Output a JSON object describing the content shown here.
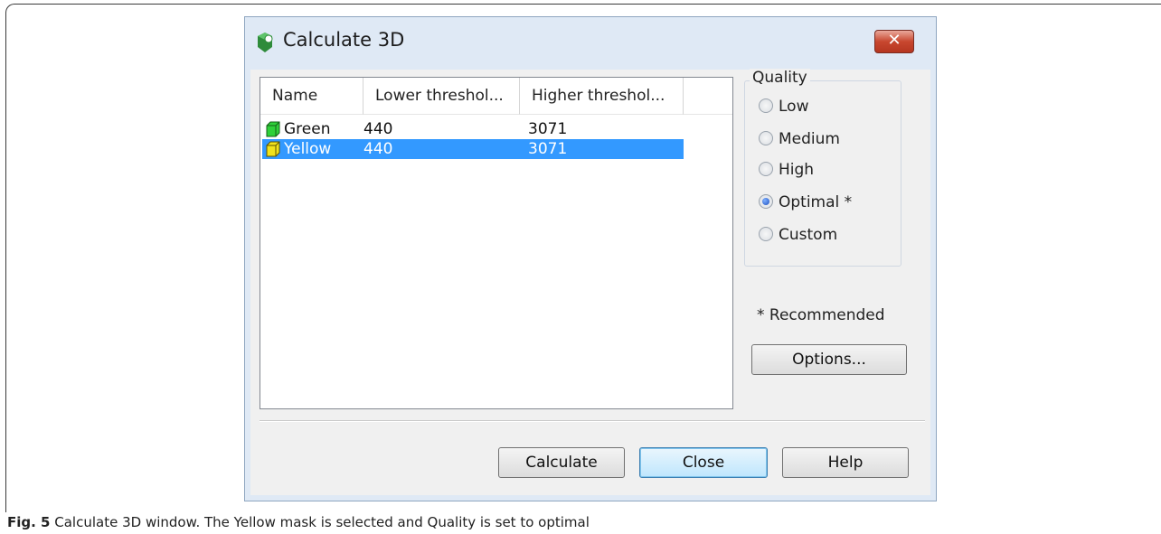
{
  "window": {
    "title": "Calculate 3D",
    "close_label": "✕"
  },
  "list": {
    "columns": [
      "Name",
      "Lower threshol...",
      "Higher threshol..."
    ],
    "rows": [
      {
        "name": "Green",
        "lower": "440",
        "higher": "3071",
        "color": "#2fd13a",
        "selected": false
      },
      {
        "name": "Yellow",
        "lower": "440",
        "higher": "3071",
        "color": "#f2e31b",
        "selected": true
      }
    ]
  },
  "quality": {
    "label": "Quality",
    "options": [
      "Low",
      "Medium",
      "High",
      "Optimal *",
      "Custom"
    ],
    "selected": "Optimal *"
  },
  "note": "* Recommended",
  "buttons": {
    "options": "Options...",
    "calculate": "Calculate",
    "close": "Close",
    "help": "Help"
  },
  "caption": {
    "fig": "Fig. 5",
    "text": " Calculate 3D window. The Yellow mask is selected and Quality is set to optimal"
  },
  "colors": {
    "selection": "#3399ff",
    "title_bg": "#dfe9f5",
    "close_btn": "#c8472f"
  }
}
